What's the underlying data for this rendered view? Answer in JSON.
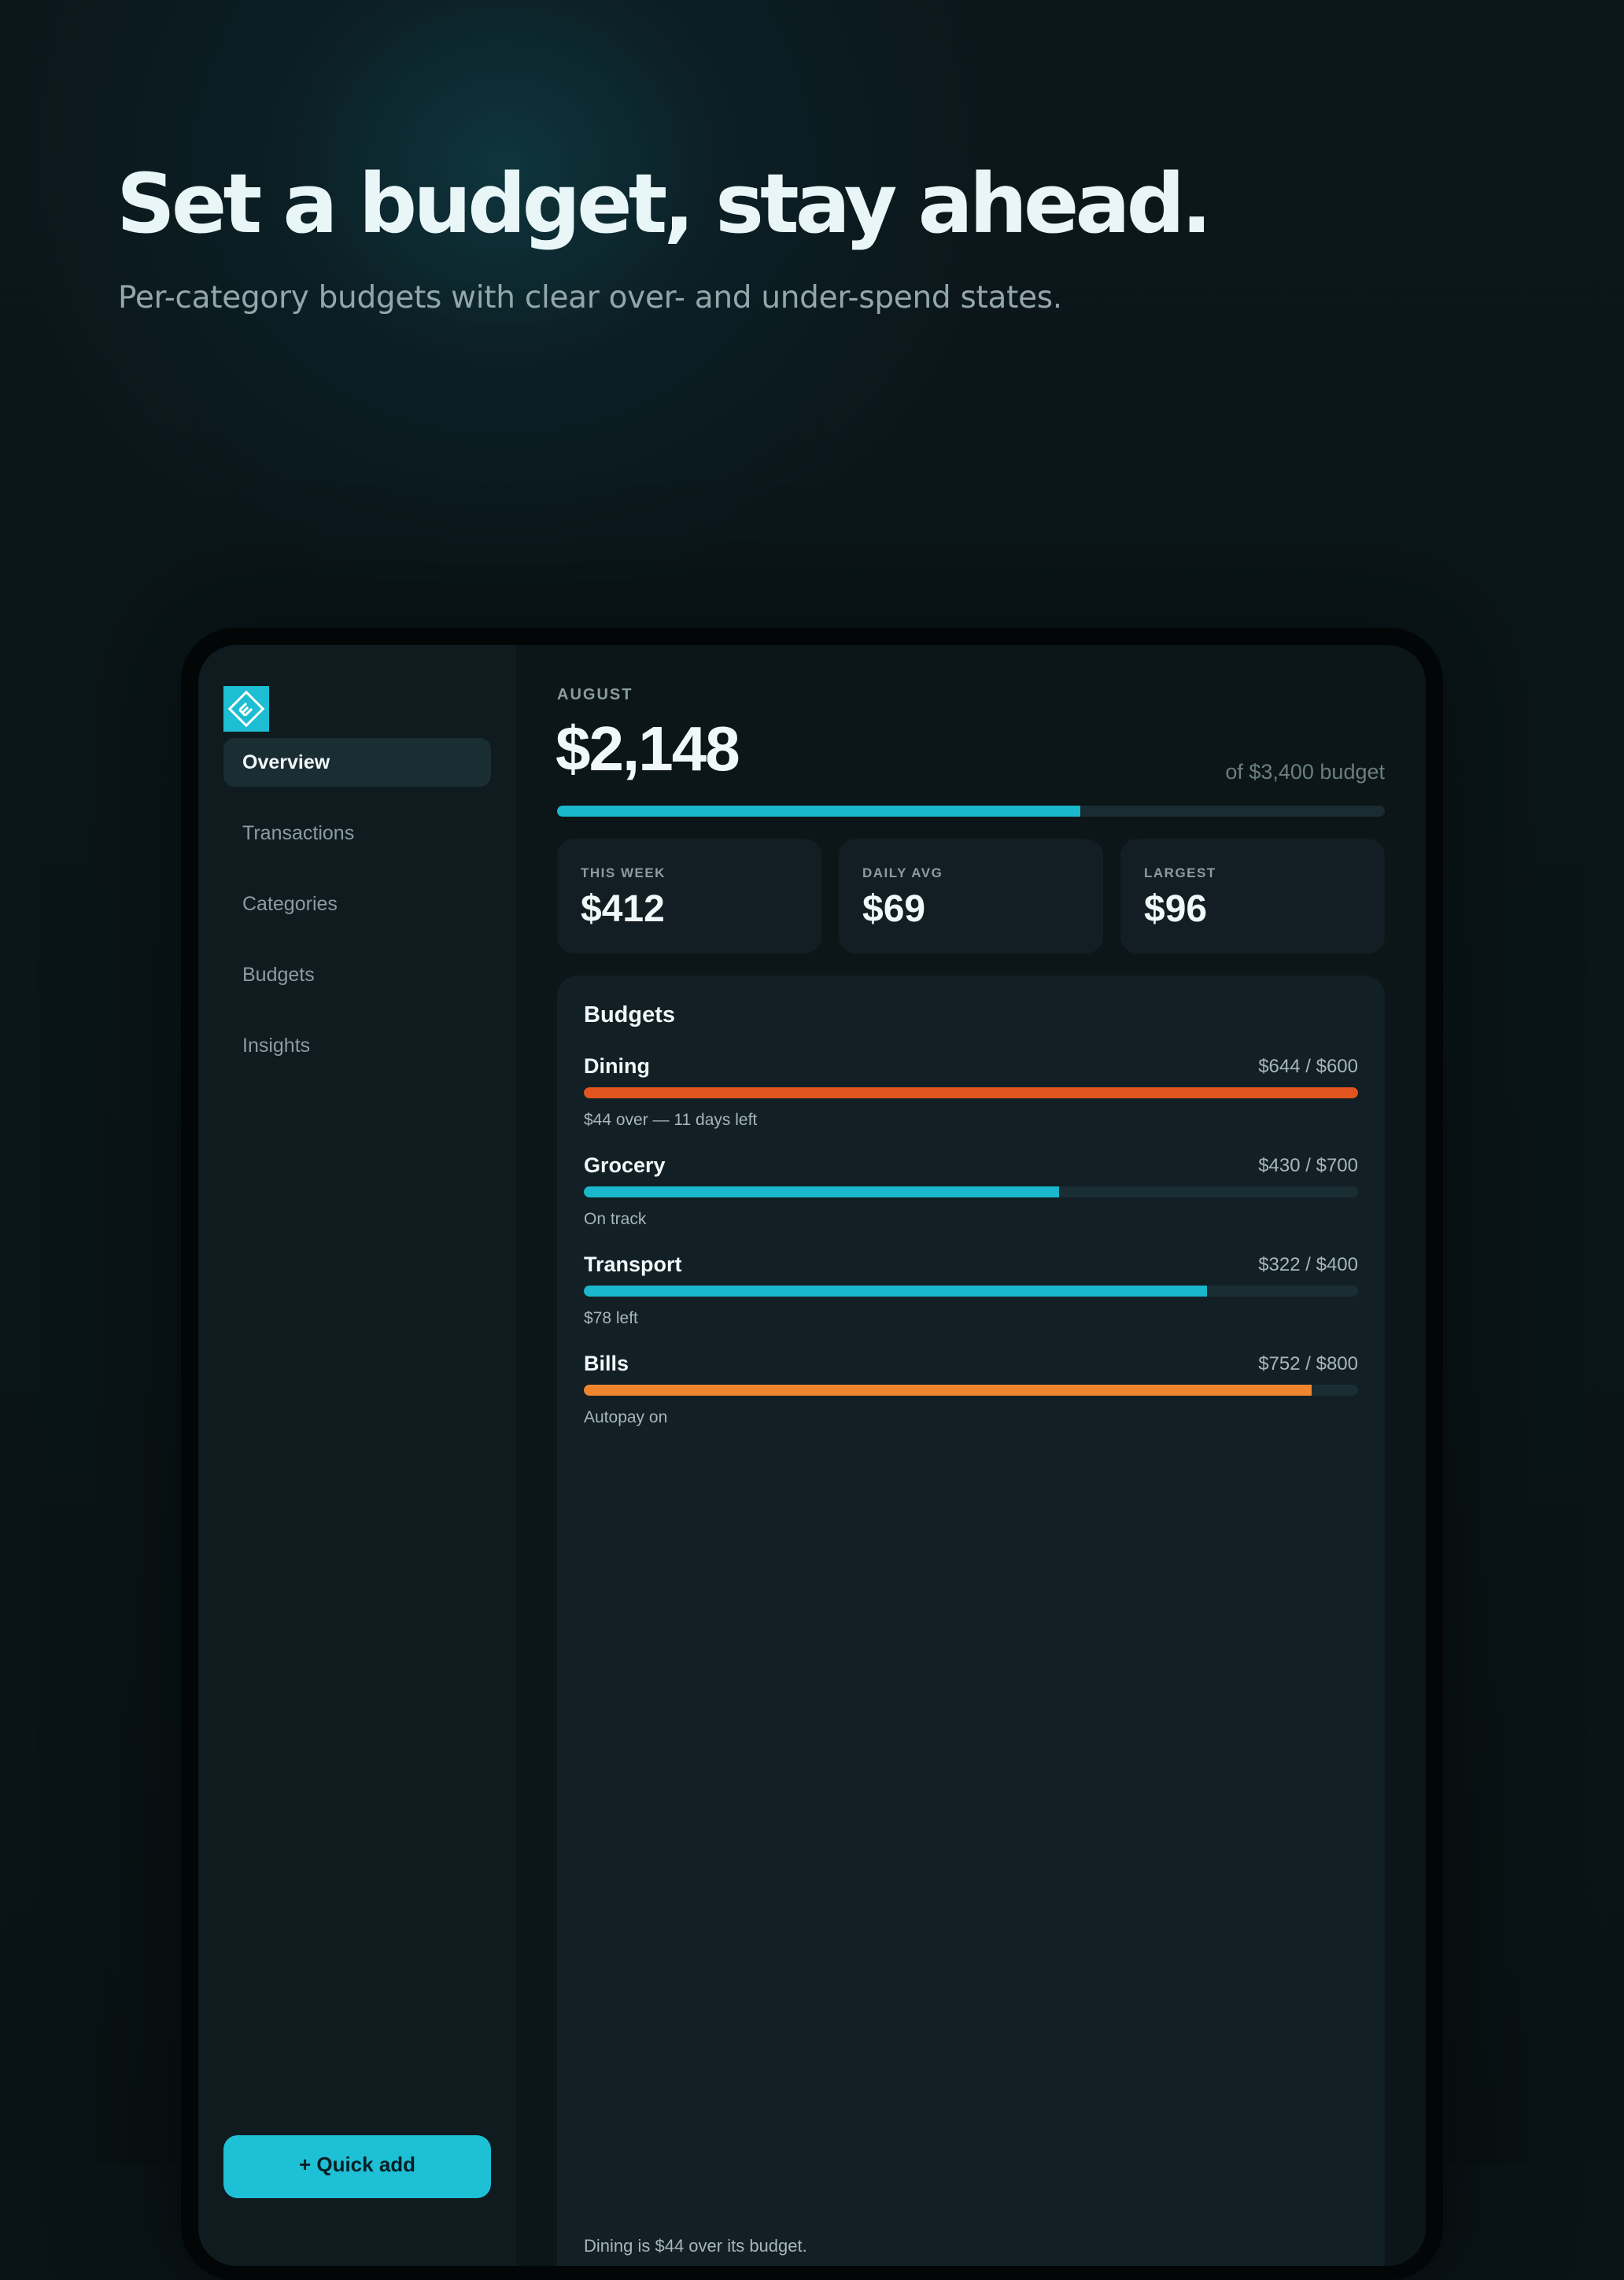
{
  "hero": {
    "title": "Set a budget, stay ahead.",
    "subtitle": "Per-category budgets with clear over- and under-spend states."
  },
  "sidebar": {
    "logo_icon": "app-logo-icon",
    "items": [
      {
        "label": "Overview",
        "active": true
      },
      {
        "label": "Transactions",
        "active": false
      },
      {
        "label": "Categories",
        "active": false
      },
      {
        "label": "Budgets",
        "active": false
      },
      {
        "label": "Insights",
        "active": false
      }
    ],
    "quick_add_label": "+ Quick add"
  },
  "summary": {
    "month": "AUGUST",
    "total": "$2,148",
    "budget_text": "of $3,400 budget",
    "progress_fraction": 0.632
  },
  "stats": [
    {
      "label": "THIS WEEK",
      "value": "$412"
    },
    {
      "label": "DAILY AVG",
      "value": "$69"
    },
    {
      "label": "LARGEST",
      "value": "$96"
    }
  ],
  "budgets": {
    "title": "Budgets",
    "rows": [
      {
        "name": "Dining",
        "amount": "$644 / $600",
        "note": "$44 over — 11 days left",
        "fraction": 1.0,
        "color": "#e2541e"
      },
      {
        "name": "Grocery",
        "amount": "$430 / $700",
        "note": "On track",
        "fraction": 0.614,
        "color": "#1ab8cc"
      },
      {
        "name": "Transport",
        "amount": "$322 / $400",
        "note": "$78 left",
        "fraction": 0.805,
        "color": "#1ab8cc"
      },
      {
        "name": "Bills",
        "amount": "$752 / $800",
        "note": "Autopay on",
        "fraction": 0.94,
        "color": "#f08530"
      }
    ],
    "footer": "Dining is $44 over its budget."
  },
  "colors": {
    "accent": "#1ec0d6",
    "over": "#e2541e",
    "warning": "#f08530"
  }
}
